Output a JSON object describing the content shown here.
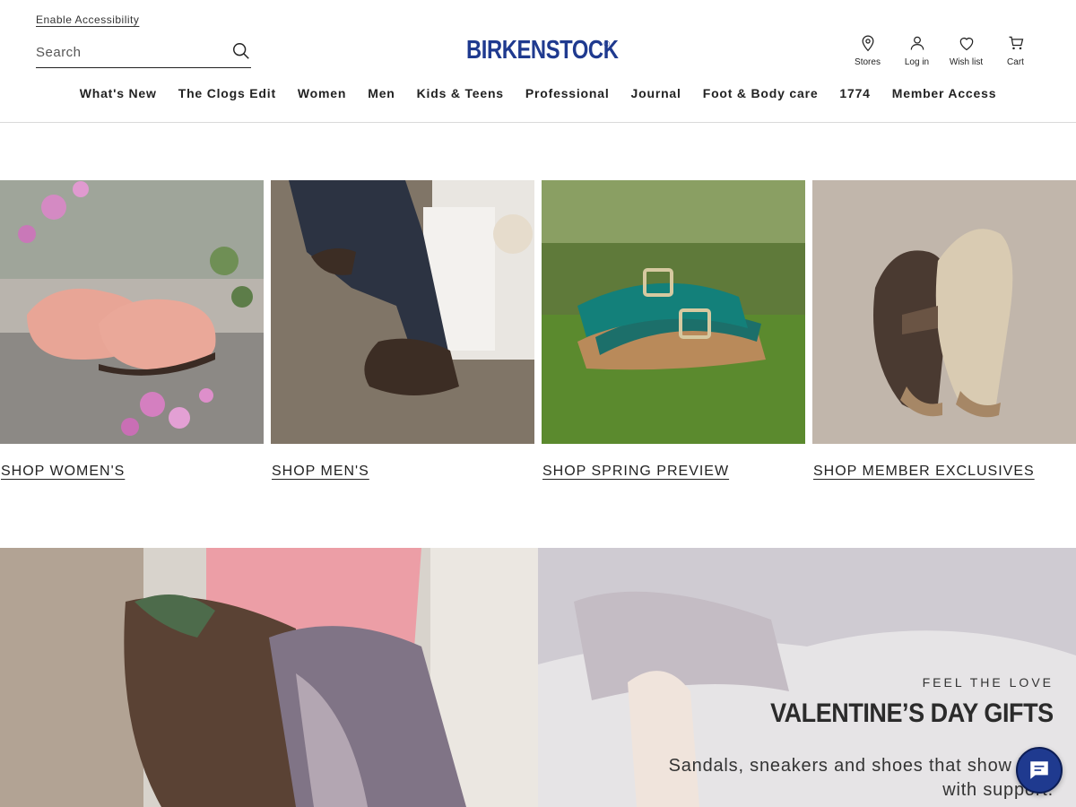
{
  "header": {
    "accessibility_link": "Enable Accessibility",
    "search_placeholder": "Search",
    "logo_text": "BIRKENSTOCK",
    "logo_mark": "®",
    "utility": [
      {
        "label": "Stores",
        "icon": "location-pin-icon"
      },
      {
        "label": "Log in",
        "icon": "user-icon"
      },
      {
        "label": "Wish list",
        "icon": "heart-icon"
      },
      {
        "label": "Cart",
        "icon": "cart-icon"
      }
    ]
  },
  "nav": {
    "items": [
      "What's New",
      "The Clogs Edit",
      "Women",
      "Men",
      "Kids & Teens",
      "Professional",
      "Journal",
      "Foot & Body care",
      "1774",
      "Member Access"
    ]
  },
  "tiles": [
    {
      "cta": "SHOP WOMEN'S",
      "image": "pink-suede-loafer-clog-with-flowers"
    },
    {
      "cta": "SHOP MEN'S",
      "image": "brown-suede-clog-on-foot"
    },
    {
      "cta": "SHOP SPRING PREVIEW",
      "image": "teal-two-strap-sandal-on-grass"
    },
    {
      "cta": "SHOP MEMBER EXCLUSIVES",
      "image": "brown-and-beige-buckle-clogs"
    }
  ],
  "hero": {
    "eyebrow": "FEEL THE LOVE",
    "headline": "VALENTINE’S DAY GIFTS",
    "subtext": "Sandals, sneakers and shoes that show love with support."
  },
  "chat": {
    "icon": "chat-bubble-icon"
  },
  "colors": {
    "brand_blue": "#1f3a8f",
    "text": "#222222",
    "divider": "#d9d9d9"
  }
}
